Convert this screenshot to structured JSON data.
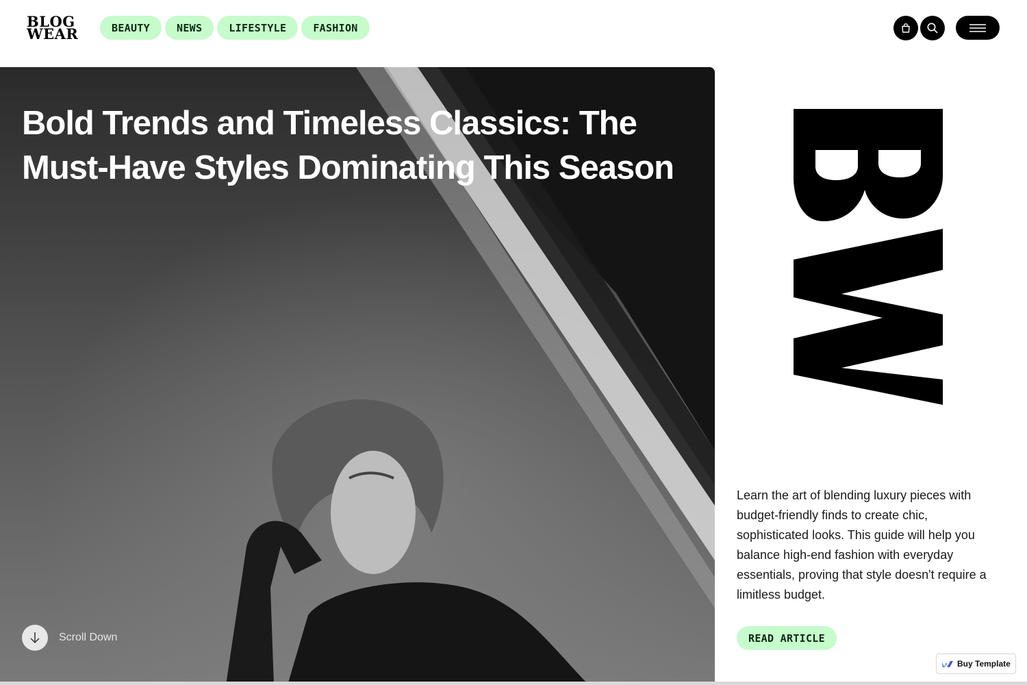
{
  "brand": {
    "line1": "BLOG",
    "line2": "WEAR"
  },
  "nav": [
    {
      "label": "BEAUTY"
    },
    {
      "label": "NEWS"
    },
    {
      "label": "LIFESTYLE"
    },
    {
      "label": "FASHION"
    }
  ],
  "icons": {
    "cart": "cart-icon",
    "search": "search-icon",
    "menu": "menu-icon"
  },
  "hero": {
    "title": "Bold Trends and Timeless Classics: The Must-Have Styles Dominating This Season",
    "scroll_label": "Scroll Down"
  },
  "side": {
    "summary": "Learn the art of blending luxury pieces with budget-friendly finds to create chic, sophisticated looks. This guide will help you balance high-end fashion with everyday essentials, proving that style doesn't require a limitless budget.",
    "read_label": "READ ARTICLE"
  },
  "badge": {
    "label": "Buy Template"
  },
  "colors": {
    "accent": "#c6fbcc",
    "accent_text": "#0c2a12",
    "dark": "#000000"
  }
}
